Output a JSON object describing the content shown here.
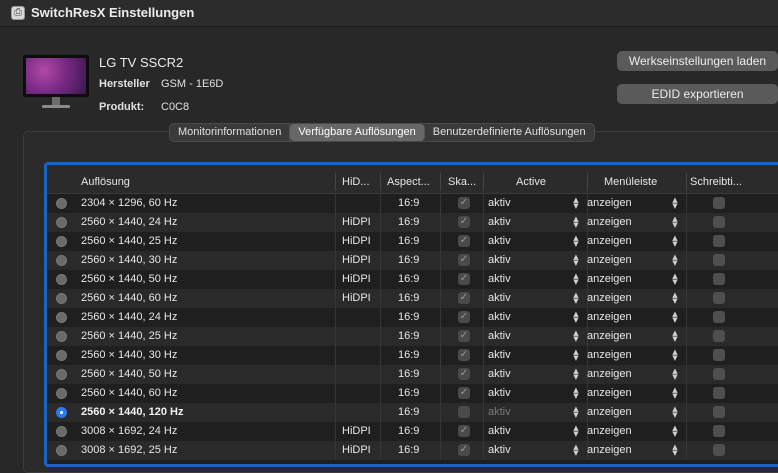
{
  "window": {
    "title": "SwitchResX Einstellungen",
    "app_icon": "app-icon"
  },
  "monitor": {
    "name": "LG TV SSCR2",
    "manufacturer_label": "Hersteller",
    "manufacturer_value": "GSM - 1E6D",
    "product_label": "Produkt:",
    "product_value": "C0C8"
  },
  "buttons": {
    "factory_defaults": "Werkseinstellungen laden",
    "export_edid": "EDID exportieren"
  },
  "tabs": [
    {
      "label": "Monitorinformationen",
      "active": false
    },
    {
      "label": "Verfügbare Auflösungen",
      "active": true
    },
    {
      "label": "Benutzerdefinierte Auflösungen",
      "active": false
    }
  ],
  "table": {
    "columns": [
      "Auflösung",
      "HiD...",
      "Aspect...",
      "Ska...",
      "Active",
      "Menüleiste",
      "Schreibti..."
    ],
    "rows": [
      {
        "res": "2304 × 1296, 60 Hz",
        "hidpi": "",
        "aspect": "16:9",
        "active": "aktiv",
        "menu": "anzeigen",
        "selected": false
      },
      {
        "res": "2560 × 1440, 24 Hz",
        "hidpi": "HiDPI",
        "aspect": "16:9",
        "active": "aktiv",
        "menu": "anzeigen",
        "selected": false
      },
      {
        "res": "2560 × 1440, 25 Hz",
        "hidpi": "HiDPI",
        "aspect": "16:9",
        "active": "aktiv",
        "menu": "anzeigen",
        "selected": false
      },
      {
        "res": "2560 × 1440, 30 Hz",
        "hidpi": "HiDPI",
        "aspect": "16:9",
        "active": "aktiv",
        "menu": "anzeigen",
        "selected": false
      },
      {
        "res": "2560 × 1440, 50 Hz",
        "hidpi": "HiDPI",
        "aspect": "16:9",
        "active": "aktiv",
        "menu": "anzeigen",
        "selected": false
      },
      {
        "res": "2560 × 1440, 60 Hz",
        "hidpi": "HiDPI",
        "aspect": "16:9",
        "active": "aktiv",
        "menu": "anzeigen",
        "selected": false
      },
      {
        "res": "2560 × 1440, 24 Hz",
        "hidpi": "",
        "aspect": "16:9",
        "active": "aktiv",
        "menu": "anzeigen",
        "selected": false
      },
      {
        "res": "2560 × 1440, 25 Hz",
        "hidpi": "",
        "aspect": "16:9",
        "active": "aktiv",
        "menu": "anzeigen",
        "selected": false
      },
      {
        "res": "2560 × 1440, 30 Hz",
        "hidpi": "",
        "aspect": "16:9",
        "active": "aktiv",
        "menu": "anzeigen",
        "selected": false
      },
      {
        "res": "2560 × 1440, 50 Hz",
        "hidpi": "",
        "aspect": "16:9",
        "active": "aktiv",
        "menu": "anzeigen",
        "selected": false
      },
      {
        "res": "2560 × 1440, 60 Hz",
        "hidpi": "",
        "aspect": "16:9",
        "active": "aktiv",
        "menu": "anzeigen",
        "selected": false
      },
      {
        "res": "2560 × 1440, 120 Hz",
        "hidpi": "",
        "aspect": "16:9",
        "active": "aktiv",
        "menu": "anzeigen",
        "selected": true
      },
      {
        "res": "3008 × 1692, 24 Hz",
        "hidpi": "HiDPI",
        "aspect": "16:9",
        "active": "aktiv",
        "menu": "anzeigen",
        "selected": false
      },
      {
        "res": "3008 × 1692, 25 Hz",
        "hidpi": "HiDPI",
        "aspect": "16:9",
        "active": "aktiv",
        "menu": "anzeigen",
        "selected": false
      }
    ]
  },
  "colors": {
    "accent": "#1b65c2",
    "radio_selected": "#2a7bf0",
    "background": "#282828"
  }
}
